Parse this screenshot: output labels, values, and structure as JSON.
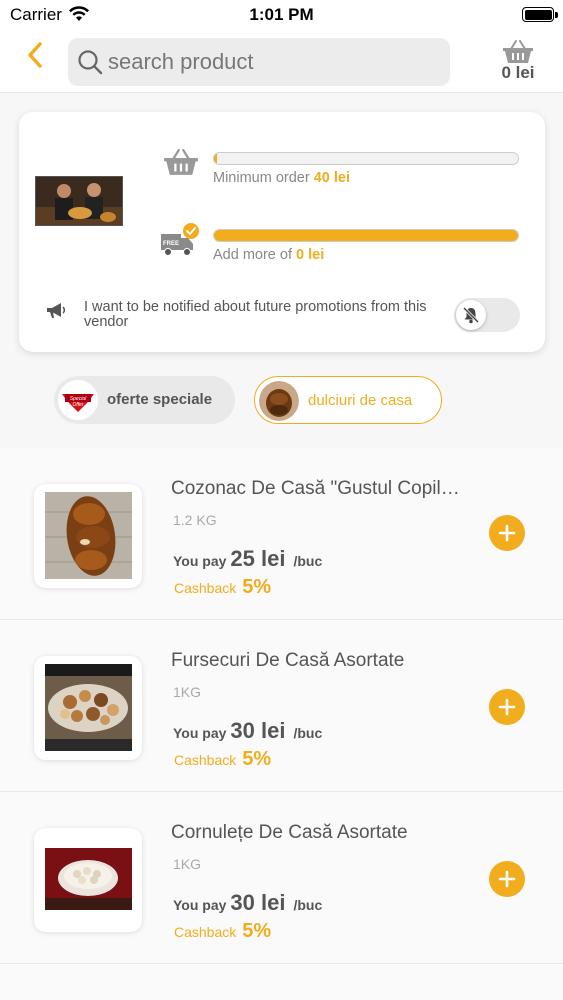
{
  "status_bar": {
    "carrier": "Carrier",
    "time": "1:01 PM"
  },
  "header": {
    "search_placeholder": "search product",
    "cart_total": "0 lei"
  },
  "vendor": {
    "min_order_label": "Minimum order",
    "min_order_value": "40 lei",
    "min_order_progress": 0.01,
    "add_more_label": "Add more of",
    "add_more_value": "0 lei",
    "delivery_progress": 1.0,
    "notify_text": "I want to be notified about future promotions from this vendor",
    "notify_enabled": false
  },
  "categories": [
    {
      "label": "oferte speciale",
      "active": false
    },
    {
      "label": "dulciuri de casa",
      "active": true
    }
  ],
  "products": [
    {
      "name": "Cozonac De Casă \"Gustul Copilăriei\"",
      "quantity": "1.2 KG",
      "pay_label": "You pay",
      "price": "25 lei",
      "unit": "/buc",
      "cashback_label": "Cashback",
      "cashback": "5%"
    },
    {
      "name": "Fursecuri De Casă Asortate",
      "quantity": "1KG",
      "pay_label": "You pay",
      "price": "30 lei",
      "unit": "/buc",
      "cashback_label": "Cashback",
      "cashback": "5%"
    },
    {
      "name": "Cornulețe De Casă Asortate",
      "quantity": "1KG",
      "pay_label": "You pay",
      "price": "30 lei",
      "unit": "/buc",
      "cashback_label": "Cashback",
      "cashback": "5%"
    }
  ],
  "colors": {
    "accent": "#f1ad1d",
    "text": "#555555",
    "muted": "#aaaaaa"
  }
}
